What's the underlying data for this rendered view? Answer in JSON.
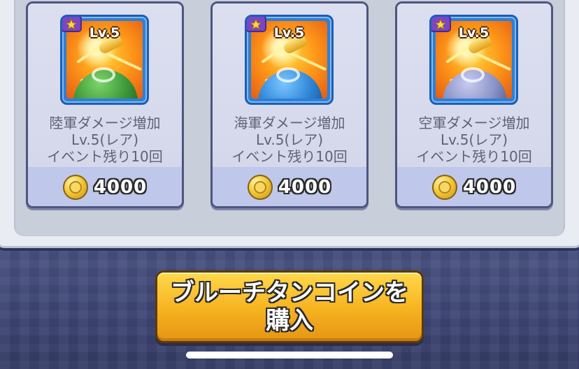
{
  "shop": {
    "items": [
      {
        "level_label": "Lv.5",
        "title": "陸軍ダメージ増加",
        "subtitle": "Lv.5(レア)",
        "remaining": "イベント残り10回",
        "price": "4000",
        "helmet_color": "#3d9a3a",
        "rarity_icon": "star-icon"
      },
      {
        "level_label": "Lv.5",
        "title": "海軍ダメージ増加",
        "subtitle": "Lv.5(レア)",
        "remaining": "イベント残り10回",
        "price": "4000",
        "helmet_color": "#2f87d8",
        "rarity_icon": "star-icon"
      },
      {
        "level_label": "Lv.5",
        "title": "空軍ダメージ増加",
        "subtitle": "Lv.5(レア)",
        "remaining": "イベント残り10回",
        "price": "4000",
        "helmet_color": "#8a93c8",
        "rarity_icon": "star-icon"
      }
    ],
    "currency_icon": "gold-coin-icon"
  },
  "buy_button": {
    "line1": "ブルーチタンコインを",
    "line2": "購入"
  },
  "colors": {
    "button": "#f6b21f",
    "panel": "#e9ecf2",
    "card_border": "#4d567f",
    "rarity_badge": "#7a45c9"
  }
}
